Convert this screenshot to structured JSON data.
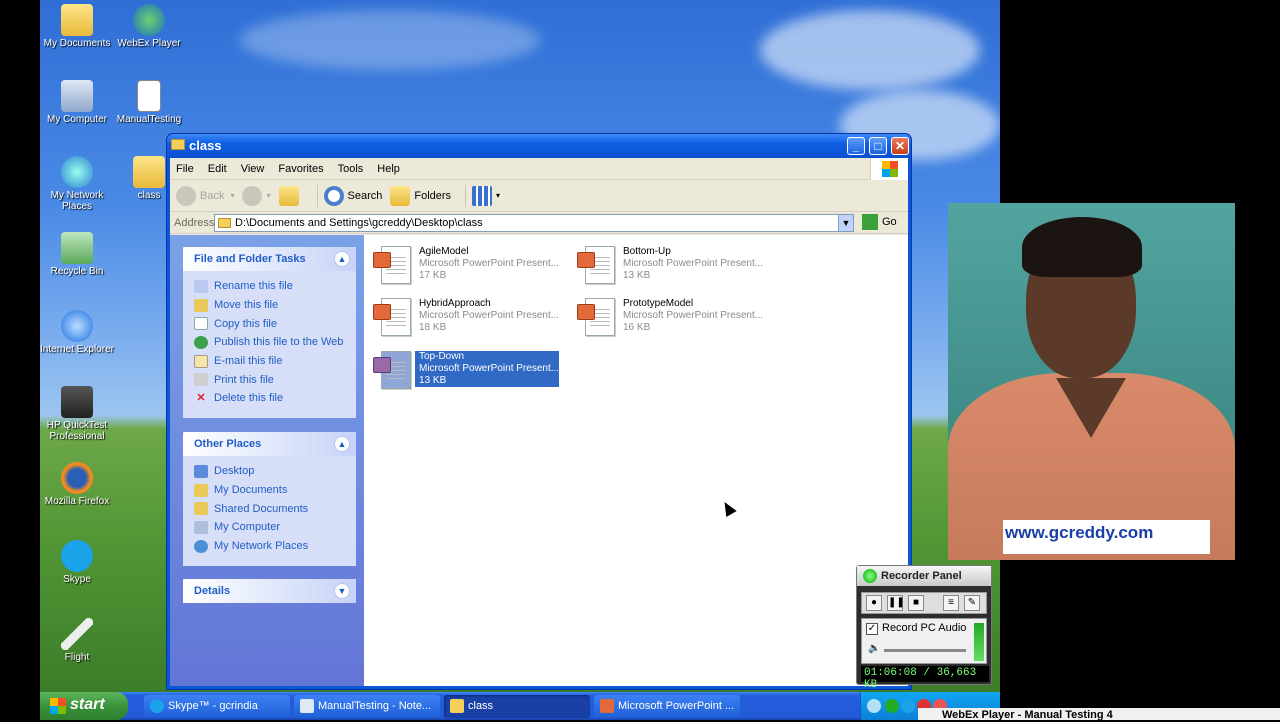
{
  "desktop": {
    "icons": [
      {
        "label": "My Documents"
      },
      {
        "label": "WebEx Player"
      },
      {
        "label": "My Computer"
      },
      {
        "label": "ManualTesting"
      },
      {
        "label": "My Network Places"
      },
      {
        "label": "class"
      },
      {
        "label": "Recycle Bin"
      },
      {
        "label": "Internet Explorer"
      },
      {
        "label": "HP QuickTest Professional"
      },
      {
        "label": "Mozilla Firefox"
      },
      {
        "label": "Skype"
      },
      {
        "label": "Flight"
      }
    ]
  },
  "window": {
    "title": "class",
    "menu": [
      "File",
      "Edit",
      "View",
      "Favorites",
      "Tools",
      "Help"
    ],
    "toolbar": {
      "back": "Back",
      "search": "Search",
      "folders": "Folders"
    },
    "address": {
      "label": "Address",
      "value": "D:\\Documents and Settings\\gcreddy\\Desktop\\class",
      "go": "Go"
    },
    "file_tasks": {
      "title": "File and Folder Tasks",
      "items": [
        {
          "label": "Rename this file",
          "icon": "rename-icon"
        },
        {
          "label": "Move this file",
          "icon": "move-icon"
        },
        {
          "label": "Copy this file",
          "icon": "copy-icon"
        },
        {
          "label": "Publish this file to the Web",
          "icon": "globe-icon"
        },
        {
          "label": "E-mail this file",
          "icon": "mail-icon"
        },
        {
          "label": "Print this file",
          "icon": "printer-icon"
        },
        {
          "label": "Delete this file",
          "icon": "delete-icon"
        }
      ]
    },
    "other_places": {
      "title": "Other Places",
      "items": [
        {
          "label": "Desktop",
          "icon": "desktop-icon"
        },
        {
          "label": "My Documents",
          "icon": "folder-icon"
        },
        {
          "label": "Shared Documents",
          "icon": "folder-icon"
        },
        {
          "label": "My Computer",
          "icon": "computer-icon"
        },
        {
          "label": "My Network Places",
          "icon": "network-icon"
        }
      ]
    },
    "details": {
      "title": "Details"
    },
    "files": [
      {
        "name": "AgileModel",
        "type": "Microsoft PowerPoint Present...",
        "size": "17 KB",
        "selected": false
      },
      {
        "name": "Bottom-Up",
        "type": "Microsoft PowerPoint Present...",
        "size": "13 KB",
        "selected": false
      },
      {
        "name": "HybridApproach",
        "type": "Microsoft PowerPoint Present...",
        "size": "18 KB",
        "selected": false
      },
      {
        "name": "PrototypeModel",
        "type": "Microsoft PowerPoint Present...",
        "size": "16 KB",
        "selected": false
      },
      {
        "name": "Top-Down",
        "type": "Microsoft PowerPoint Present...",
        "size": "13 KB",
        "selected": true
      }
    ]
  },
  "webcam": {
    "watermark": "www.gcreddy.com"
  },
  "recorder": {
    "title": "Recorder Panel",
    "audio_label": "Record PC Audio",
    "status": "01:06:08 / 36,663 KB"
  },
  "taskbar": {
    "start": "start",
    "items": [
      {
        "label": "Skype™ - gcrindia",
        "active": false
      },
      {
        "label": "ManualTesting - Note...",
        "active": false
      },
      {
        "label": "class",
        "active": true
      },
      {
        "label": "Microsoft PowerPoint ...",
        "active": false
      }
    ]
  },
  "webex_bar": {
    "label": "WebEx Player - Manual Testing 4"
  },
  "colors": {
    "xp_blue": "#0a58d8",
    "task_link": "#215dc6",
    "selection": "#316ac5",
    "watermark": "#1a3fa8"
  }
}
